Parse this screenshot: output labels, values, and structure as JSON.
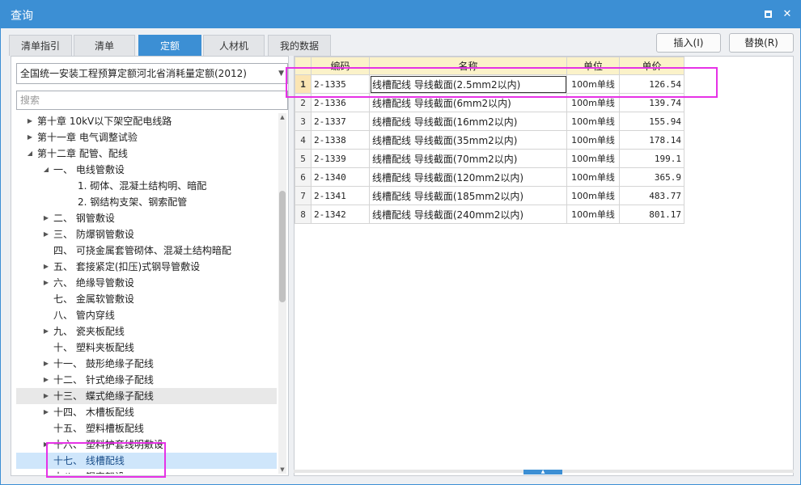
{
  "window": {
    "title": "查询"
  },
  "tabs": [
    {
      "label": "清单指引",
      "active": false
    },
    {
      "label": "清单",
      "active": false
    },
    {
      "label": "定额",
      "active": true
    },
    {
      "label": "人材机",
      "active": false
    },
    {
      "label": "我的数据",
      "active": false
    }
  ],
  "actions": {
    "insert_label": "插入(I)",
    "replace_label": "替换(R)"
  },
  "left": {
    "library_select": {
      "value": "全国统一安装工程预算定额河北省消耗量定额(2012)"
    },
    "search": {
      "placeholder": "搜索"
    },
    "tree": [
      {
        "label": "第十章 10kV以下架空配电线路",
        "level": 0,
        "expander": "collapsed"
      },
      {
        "label": "第十一章 电气调整试验",
        "level": 0,
        "expander": "collapsed"
      },
      {
        "label": "第十二章 配管、配线",
        "level": 0,
        "expander": "expanded"
      },
      {
        "label": "一、 电线管敷设",
        "level": 1,
        "expander": "expanded"
      },
      {
        "label": "1. 砌体、混凝土结构明、暗配",
        "level": 2,
        "expander": "none"
      },
      {
        "label": "2. 钢结构支架、钢索配管",
        "level": 2,
        "expander": "none"
      },
      {
        "label": "二、 钢管敷设",
        "level": 1,
        "expander": "collapsed"
      },
      {
        "label": "三、 防爆钢管敷设",
        "level": 1,
        "expander": "collapsed"
      },
      {
        "label": "四、 可挠金属套管砌体、混凝土结构暗配",
        "level": 1,
        "expander": "none"
      },
      {
        "label": "五、 套接紧定(扣压)式钢导管敷设",
        "level": 1,
        "expander": "collapsed"
      },
      {
        "label": "六、 绝缘导管敷设",
        "level": 1,
        "expander": "collapsed"
      },
      {
        "label": "七、 金属软管敷设",
        "level": 1,
        "expander": "none"
      },
      {
        "label": "八、 管内穿线",
        "level": 1,
        "expander": "none"
      },
      {
        "label": "九、 瓷夹板配线",
        "level": 1,
        "expander": "collapsed"
      },
      {
        "label": "十、 塑料夹板配线",
        "level": 1,
        "expander": "none"
      },
      {
        "label": "十一、 鼓形绝缘子配线",
        "level": 1,
        "expander": "collapsed"
      },
      {
        "label": "十二、 针式绝缘子配线",
        "level": 1,
        "expander": "collapsed"
      },
      {
        "label": "十三、 蝶式绝缘子配线",
        "level": 1,
        "expander": "collapsed",
        "state": "hover"
      },
      {
        "label": "十四、 木槽板配线",
        "level": 1,
        "expander": "collapsed"
      },
      {
        "label": "十五、 塑料槽板配线",
        "level": 1,
        "expander": "none"
      },
      {
        "label": "十六、 塑料护套线明敷设",
        "level": 1,
        "expander": "collapsed"
      },
      {
        "label": "十七、 线槽配线",
        "level": 1,
        "expander": "none",
        "state": "selected"
      },
      {
        "label": "十八、 钢索架设",
        "level": 1,
        "expander": "collapsed"
      }
    ]
  },
  "grid": {
    "columns": [
      "编码",
      "名称",
      "单位",
      "单价"
    ],
    "rows": [
      {
        "n": "1",
        "code": "2-1335",
        "name": "线槽配线 导线截面(2.5mm2以内)",
        "unit": "100m单线",
        "price": "126.54",
        "selected": true
      },
      {
        "n": "2",
        "code": "2-1336",
        "name": "线槽配线 导线截面(6mm2以内)",
        "unit": "100m单线",
        "price": "139.74"
      },
      {
        "n": "3",
        "code": "2-1337",
        "name": "线槽配线 导线截面(16mm2以内)",
        "unit": "100m单线",
        "price": "155.94"
      },
      {
        "n": "4",
        "code": "2-1338",
        "name": "线槽配线 导线截面(35mm2以内)",
        "unit": "100m单线",
        "price": "178.14"
      },
      {
        "n": "5",
        "code": "2-1339",
        "name": "线槽配线 导线截面(70mm2以内)",
        "unit": "100m单线",
        "price": "199.1"
      },
      {
        "n": "6",
        "code": "2-1340",
        "name": "线槽配线 导线截面(120mm2以内)",
        "unit": "100m单线",
        "price": "365.9"
      },
      {
        "n": "7",
        "code": "2-1341",
        "name": "线槽配线 导线截面(185mm2以内)",
        "unit": "100m单线",
        "price": "483.77"
      },
      {
        "n": "8",
        "code": "2-1342",
        "name": "线槽配线 导线截面(240mm2以内)",
        "unit": "100m单线",
        "price": "801.17"
      }
    ]
  },
  "colors": {
    "accent": "#3c8fd4",
    "header_bg": "#fbf2c9",
    "highlight": "#e632e6",
    "tree_selected": "#cfe6fb"
  }
}
